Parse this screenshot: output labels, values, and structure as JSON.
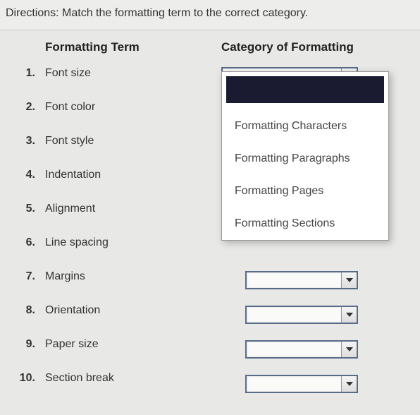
{
  "directions": "Directions: Match the formatting term to the correct category.",
  "headers": {
    "term": "Formatting Term",
    "category": "Category of Formatting"
  },
  "terms": [
    {
      "num": "1.",
      "label": "Font size"
    },
    {
      "num": "2.",
      "label": "Font color"
    },
    {
      "num": "3.",
      "label": "Font style"
    },
    {
      "num": "4.",
      "label": "Indentation"
    },
    {
      "num": "5.",
      "label": "Alignment"
    },
    {
      "num": "6.",
      "label": "Line spacing"
    },
    {
      "num": "7.",
      "label": "Margins"
    },
    {
      "num": "8.",
      "label": "Orientation"
    },
    {
      "num": "9.",
      "label": "Paper size"
    },
    {
      "num": "10.",
      "label": "Section break"
    }
  ],
  "dropdown_options": [
    "Formatting Characters",
    "Formatting Paragraphs",
    "Formatting Pages",
    "Formatting Sections"
  ]
}
